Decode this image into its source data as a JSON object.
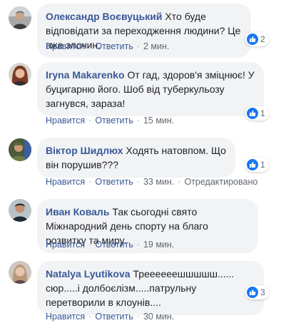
{
  "comments": [
    {
      "author": "Олександр Воєвуцький",
      "text": "Хто буде відповідати за переходження людини? Це вже злочин.",
      "reactions": "2",
      "like": "Нравится",
      "reply": "Ответить",
      "time": "2 мин.",
      "edited": ""
    },
    {
      "author": "Iryna Makarenko",
      "text": "От гад, здоров'я зміцнює! У буцигарню його. Шоб від туберкульозу загнувся, зараза!",
      "reactions": "1",
      "like": "Нравится",
      "reply": "Ответить",
      "time": "15 мин.",
      "edited": ""
    },
    {
      "author": "Віктор Шидлюх",
      "text": "Ходять натовпом. Що він порушив???",
      "reactions": "1",
      "like": "Нравится",
      "reply": "Ответить",
      "time": "33 мин.",
      "edited": "Отредактировано"
    },
    {
      "author": "Иван Коваль",
      "text": "Так сьогодні свято Міжнародний день спорту на благо розвитку та миру.",
      "reactions": "",
      "like": "Нравится",
      "reply": "Ответить",
      "time": "19 мин.",
      "edited": ""
    },
    {
      "author": "Natalya Lyutikova",
      "text": "Треееееешшшшш...... сюр.....і долбоєлізм.....патрульну перетворили в клоунів....",
      "reactions": "3",
      "like": "Нравится",
      "reply": "Ответить",
      "time": "30 мин.",
      "edited": ""
    }
  ],
  "colors": {
    "bubble": "#f2f3f5",
    "author": "#385898",
    "like": "#1877f2",
    "meta": "#606770"
  },
  "icons": {
    "like": "thumbs-up-icon"
  }
}
